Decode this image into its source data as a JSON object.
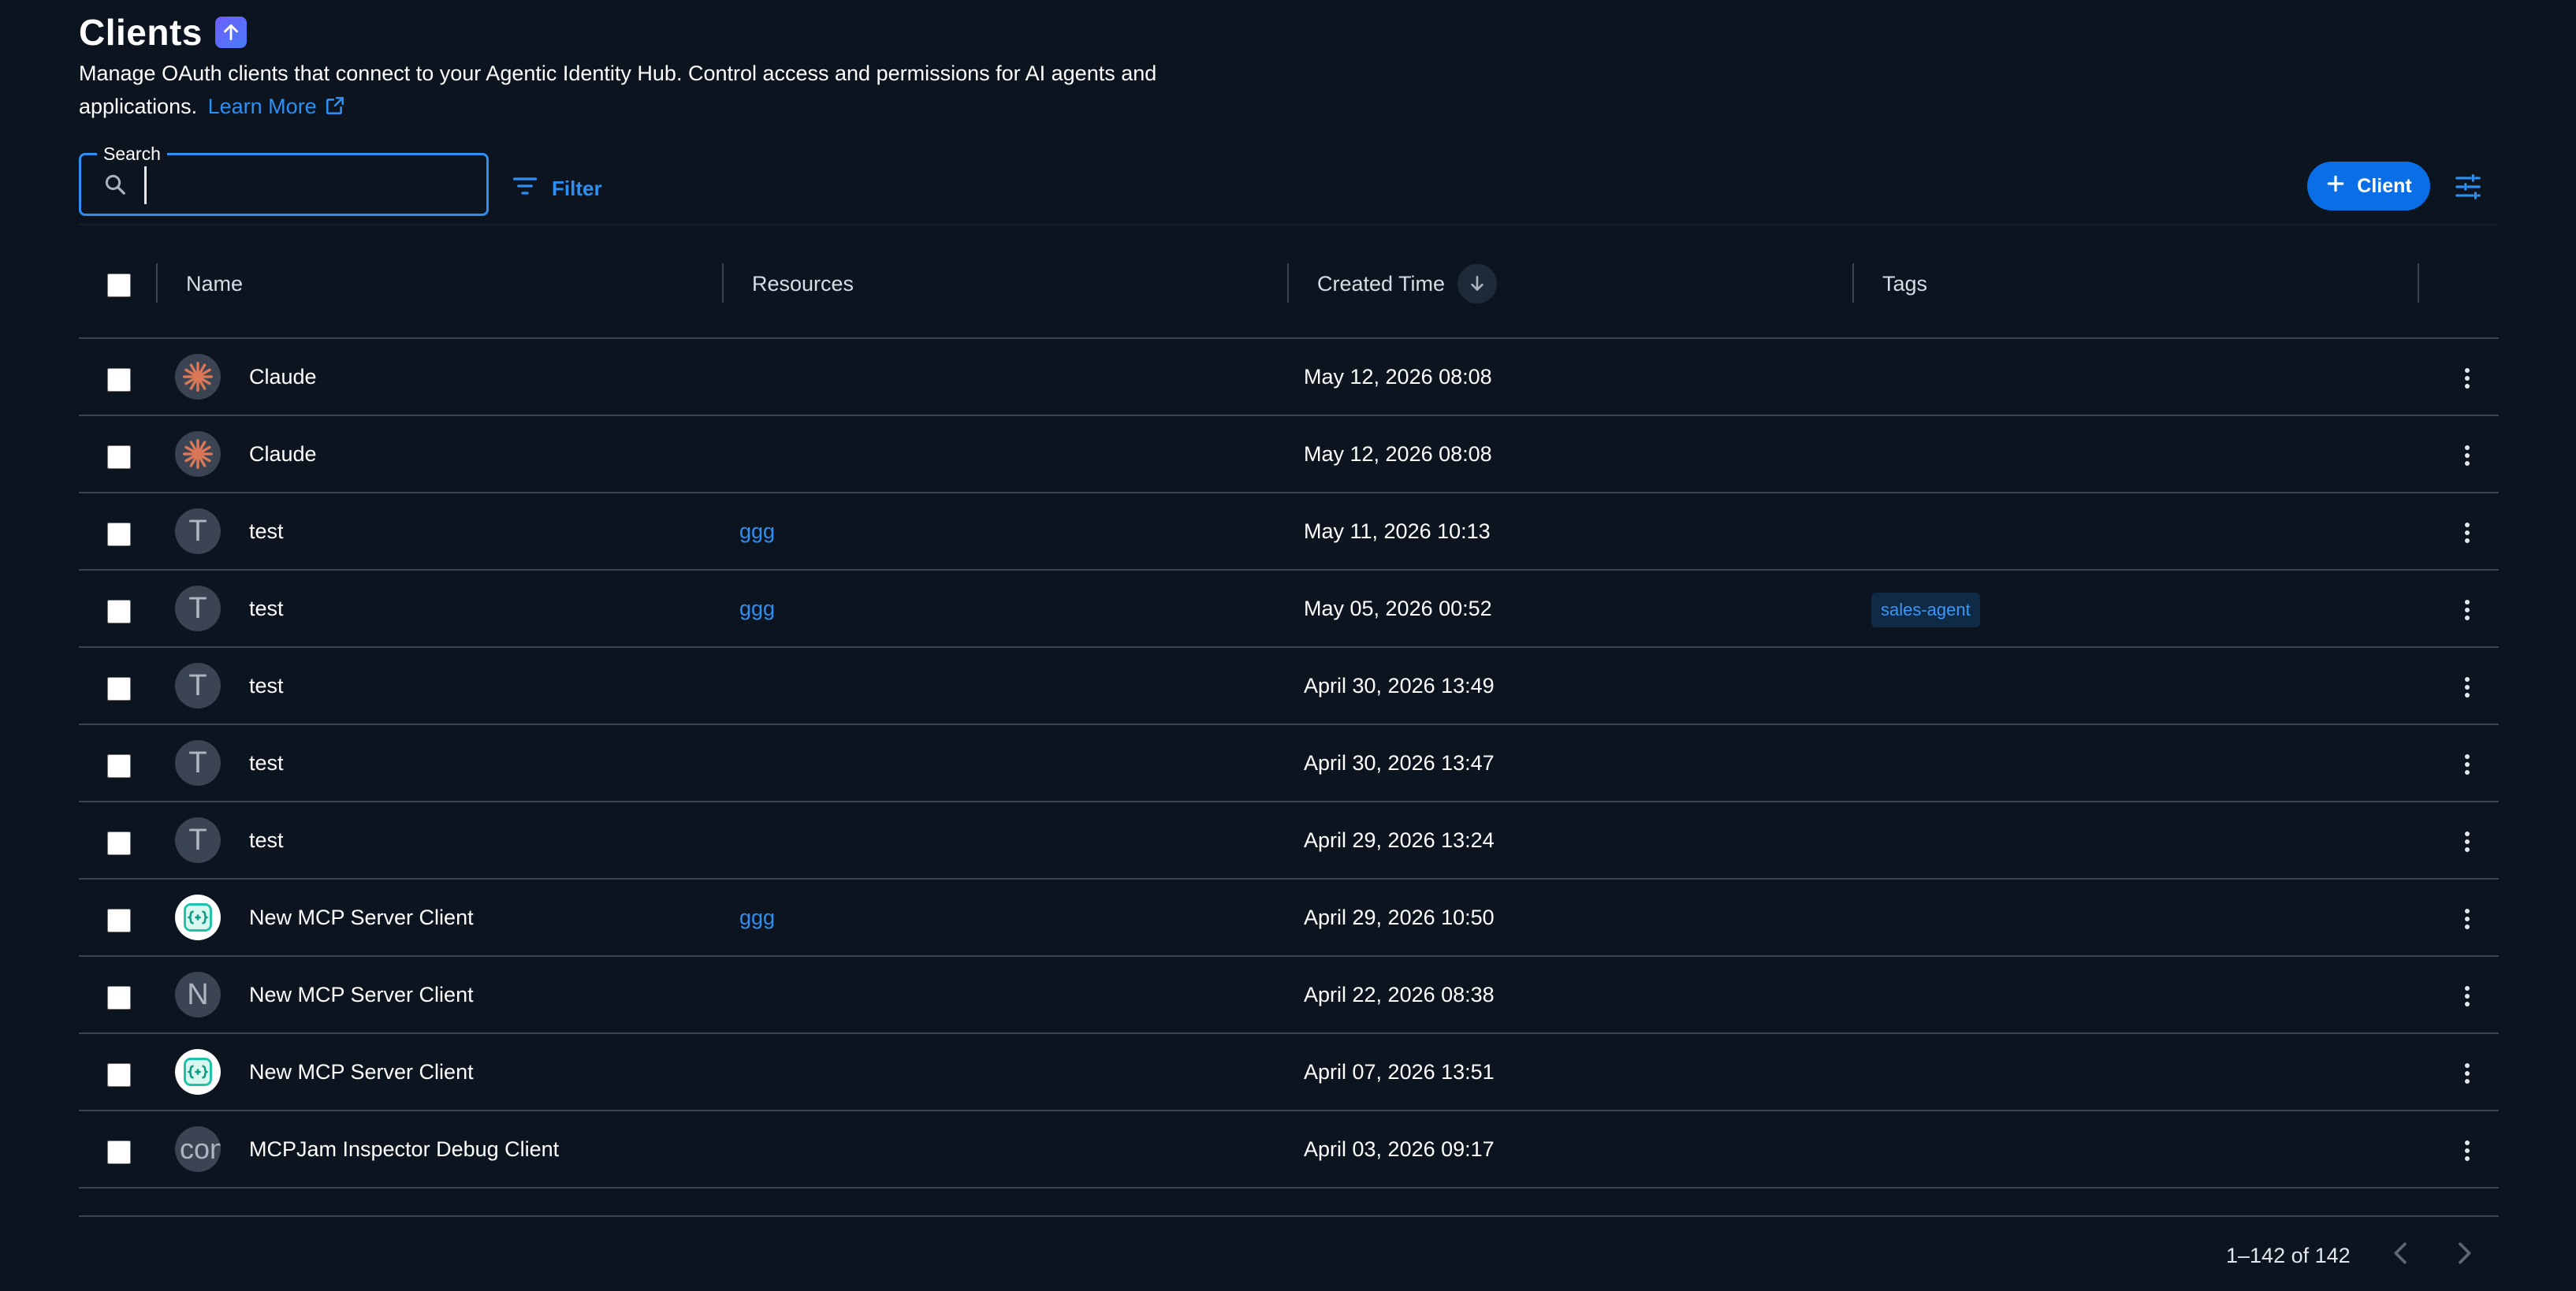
{
  "header": {
    "title": "Clients",
    "description": "Manage OAuth clients that connect to your Agentic Identity Hub. Control access and permissions for AI agents and applications.",
    "learn_more": "Learn More"
  },
  "toolbar": {
    "search_label": "Search",
    "search_value": "",
    "filter_label": "Filter",
    "add_client_label": "Client"
  },
  "table": {
    "columns": {
      "name": "Name",
      "resources": "Resources",
      "created_time": "Created Time",
      "tags": "Tags"
    },
    "sort": {
      "column": "Created Time",
      "direction": "descending"
    },
    "rows": [
      {
        "avatar": "claude-icon",
        "name": "Claude",
        "resources": "",
        "created": "May 12, 2026 08:08",
        "tag": ""
      },
      {
        "avatar": "claude-icon",
        "name": "Claude",
        "resources": "",
        "created": "May 12, 2026 08:08",
        "tag": ""
      },
      {
        "avatar": "T",
        "name": "test",
        "resources": "ggg",
        "created": "May 11, 2026 10:13",
        "tag": ""
      },
      {
        "avatar": "T",
        "name": "test",
        "resources": "ggg",
        "created": "May 05, 2026 00:52",
        "tag": "sales-agent"
      },
      {
        "avatar": "T",
        "name": "test",
        "resources": "",
        "created": "April 30, 2026 13:49",
        "tag": ""
      },
      {
        "avatar": "T",
        "name": "test",
        "resources": "",
        "created": "April 30, 2026 13:47",
        "tag": ""
      },
      {
        "avatar": "T",
        "name": "test",
        "resources": "",
        "created": "April 29, 2026 13:24",
        "tag": ""
      },
      {
        "avatar": "mcp-icon",
        "name": "New MCP Server Client",
        "resources": "ggg",
        "created": "April 29, 2026 10:50",
        "tag": ""
      },
      {
        "avatar": "N",
        "name": "New MCP Server Client",
        "resources": "",
        "created": "April 22, 2026 08:38",
        "tag": ""
      },
      {
        "avatar": "mcp-icon",
        "name": "New MCP Server Client",
        "resources": "",
        "created": "April 07, 2026 13:51",
        "tag": ""
      },
      {
        "avatar": "con",
        "name": "MCPJam Inspector Debug Client",
        "resources": "",
        "created": "April 03, 2026 09:17",
        "tag": ""
      }
    ]
  },
  "pagination": {
    "range_text": "1–142 of 142"
  },
  "colors": {
    "background": "#0c1420",
    "accent": "#2e8ff3",
    "primary_button": "#0a6fe6",
    "divider": "#3a4452"
  }
}
